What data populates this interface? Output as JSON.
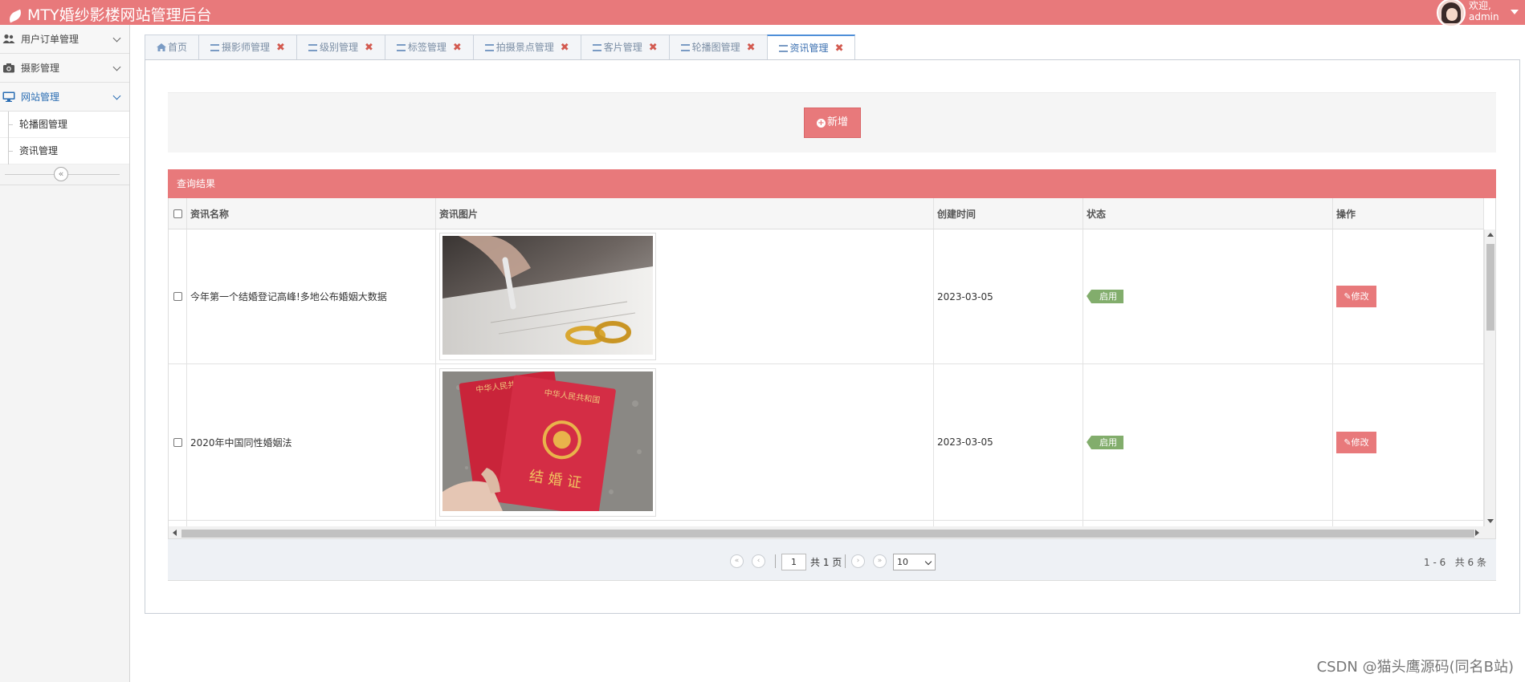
{
  "header": {
    "title": "MTY婚纱影楼网站管理后台",
    "welcome": "欢迎,",
    "username": "admin"
  },
  "sidebar": {
    "menus": [
      {
        "label": "用户订单管理",
        "icon": "users-icon"
      },
      {
        "label": "摄影管理",
        "icon": "camera-icon"
      },
      {
        "label": "网站管理",
        "icon": "monitor-icon"
      }
    ],
    "subitems": [
      {
        "label": "轮播图管理"
      },
      {
        "label": "资讯管理"
      }
    ],
    "collapse_glyph": "«"
  },
  "tabs": [
    {
      "label": "首页",
      "closable": false
    },
    {
      "label": "摄影师管理",
      "closable": true
    },
    {
      "label": "级别管理",
      "closable": true
    },
    {
      "label": "标签管理",
      "closable": true
    },
    {
      "label": "拍摄景点管理",
      "closable": true
    },
    {
      "label": "客片管理",
      "closable": true
    },
    {
      "label": "轮播图管理",
      "closable": true
    },
    {
      "label": "资讯管理",
      "closable": true,
      "active": true
    }
  ],
  "toolbar": {
    "add_label": "新增"
  },
  "results": {
    "title": "查询结果",
    "columns": [
      "资讯名称",
      "资讯图片",
      "创建时间",
      "状态",
      "操作"
    ],
    "rows": [
      {
        "name": "今年第一个结婚登记高峰!多地公布婚姻大数据",
        "date": "2023-03-05",
        "status": "启用",
        "action": "修改"
      },
      {
        "name": "2020年中国同性婚姻法",
        "date": "2023-03-05",
        "status": "启用",
        "action": "修改"
      }
    ],
    "image_texts": {
      "cert_front": "结 婚 证",
      "cert_top": "中华人民共和国",
      "cert_back": "中华人民共"
    }
  },
  "pager": {
    "page": "1",
    "total_pages": "共 1 页",
    "page_size": "10",
    "range": "1 - 6",
    "total": "共 6 条"
  },
  "watermark": "CSDN @猫头鹰源码(同名B站)",
  "colors": {
    "brand": "#e8797b",
    "status_green": "#82ad6c",
    "active_tab": "#3a6fb0"
  }
}
